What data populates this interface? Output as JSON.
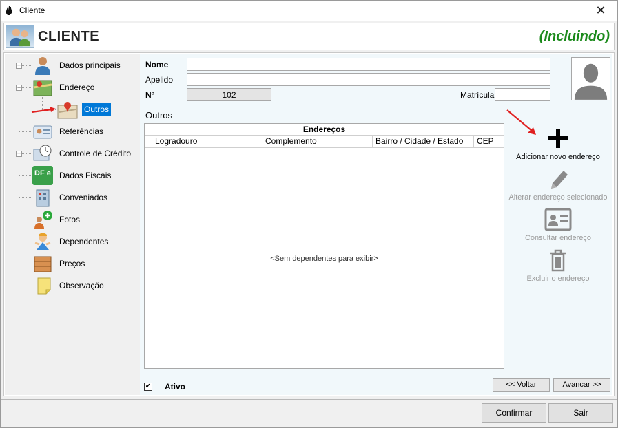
{
  "window": {
    "title": "Cliente",
    "close_glyph": "✕"
  },
  "banner": {
    "heading": "CLIENTE",
    "mode": "(Incluindo)"
  },
  "tree": {
    "items": [
      {
        "label": "Dados principais",
        "icon": "person-icon"
      },
      {
        "label": "Endereço",
        "icon": "map-icon"
      },
      {
        "label": "Outros",
        "icon": "map-pin-icon"
      },
      {
        "label": "Referências",
        "icon": "id-card-icon"
      },
      {
        "label": "Controle de Crédito",
        "icon": "credit-clock-icon"
      },
      {
        "label": "Dados Fiscais",
        "icon": "dfe-icon",
        "icon_text": "DF e"
      },
      {
        "label": "Conveniados",
        "icon": "building-icon"
      },
      {
        "label": "Fotos",
        "icon": "add-photo-icon"
      },
      {
        "label": "Dependentes",
        "icon": "child-icon"
      },
      {
        "label": "Preços",
        "icon": "box-icon"
      },
      {
        "label": "Observação",
        "icon": "note-icon"
      }
    ],
    "expanders": [
      "+",
      "−",
      "+"
    ]
  },
  "form": {
    "nome_label": "Nome",
    "nome_value": "",
    "apelido_label": "Apelido",
    "apelido_value": "",
    "numero_label": "Nº",
    "numero_value": "102",
    "matricula_label": "Matrícula",
    "matricula_value": ""
  },
  "section": {
    "title": "Outros"
  },
  "grid": {
    "caption": "Endereços",
    "columns": [
      "Logradouro",
      "Complemento",
      "Bairro / Cidade / Estado",
      "CEP"
    ],
    "empty_text": "<Sem dependentes para exibir>"
  },
  "actions": [
    {
      "label": "Adicionar novo endereço",
      "icon": "plus-icon",
      "enabled": true
    },
    {
      "label": "Alterar endereço selecionado",
      "icon": "pencil-icon",
      "enabled": false
    },
    {
      "label": "Consultar endereço",
      "icon": "id-card-icon",
      "enabled": false
    },
    {
      "label": "Excluir o endereço",
      "icon": "trash-icon",
      "enabled": false
    }
  ],
  "ativo": {
    "label": "Ativo",
    "checked": true,
    "check_glyph": "✔"
  },
  "nav": {
    "voltar": "<< Voltar",
    "avancar": "Avancar >>"
  },
  "footer": {
    "confirmar": "Confirmar",
    "sair": "Sair"
  },
  "colors": {
    "mode_green": "#1b8a1b",
    "selection_blue": "#0078d7",
    "panel_bg": "#f1f8fb",
    "arrow_red": "#e02020"
  }
}
